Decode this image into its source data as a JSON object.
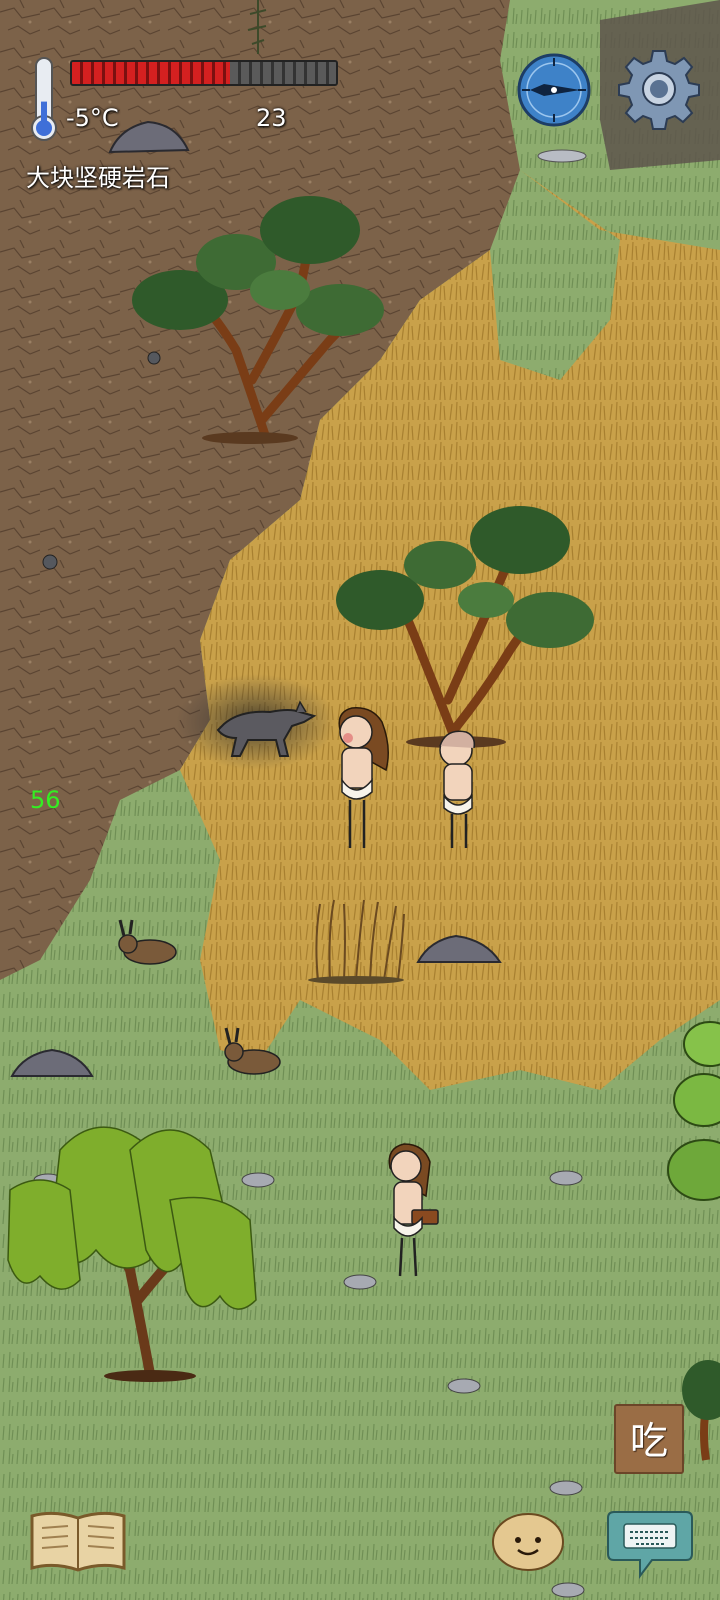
{
  "hud": {
    "temperature": "-5°C",
    "food_count": "23",
    "object_label": "大块坚硬岩石",
    "debug_number": "56",
    "food_bar_fill": 0.6,
    "thermometer_level": 0.35,
    "eat_button_label": "吃"
  },
  "icons": {
    "thermometer": "thermometer-icon",
    "compass": "compass-icon",
    "settings": "gear-icon",
    "recipe_book": "book-icon",
    "emote": "potato-face-icon",
    "chat": "keyboard-chat-icon"
  },
  "colors": {
    "food_bar_full": "#d42020",
    "food_bar_empty": "#5a5a5a",
    "eat_button": "#9a6d45",
    "debug_text": "#33ee22",
    "grassland": "#8aa86a",
    "savanna": "#c9a24a",
    "badlands": "#7a6046"
  }
}
